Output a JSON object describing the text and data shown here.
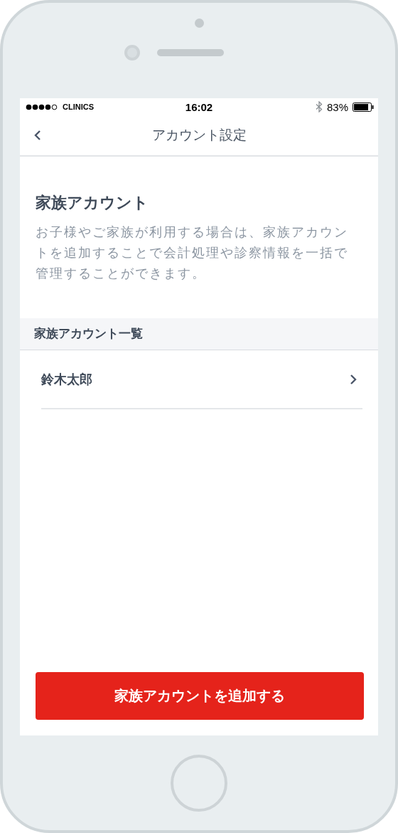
{
  "status_bar": {
    "carrier": "CLINICS",
    "time": "16:02",
    "battery": "83%"
  },
  "nav": {
    "title": "アカウント設定"
  },
  "intro": {
    "heading": "家族アカウント",
    "description": "お子様やご家族が利用する場合は、家族アカウントを追加することで会計処理や診察情報を一括で管理することができます。"
  },
  "section": {
    "title": "家族アカウント一覧"
  },
  "accounts": [
    {
      "name": "鈴木太郎"
    }
  ],
  "add_button": {
    "label": "家族アカウントを追加する"
  }
}
